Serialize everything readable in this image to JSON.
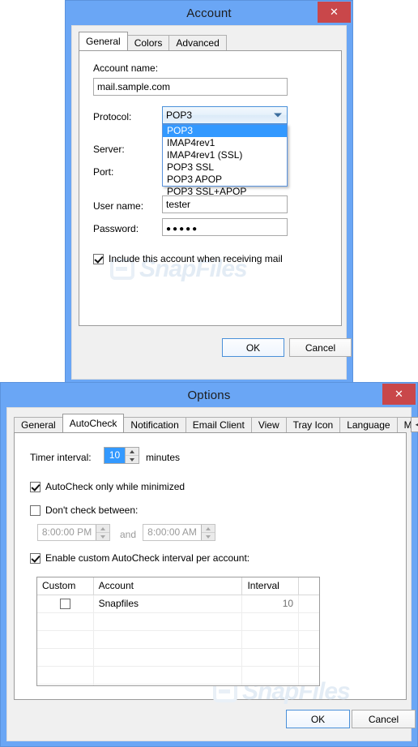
{
  "account_dialog": {
    "title": "Account",
    "close_label": "✕",
    "tabs": [
      {
        "label": "General",
        "active": true
      },
      {
        "label": "Colors",
        "active": false
      },
      {
        "label": "Advanced",
        "active": false
      }
    ],
    "fields": {
      "account_name_label": "Account name:",
      "account_name_value": "mail.sample.com",
      "protocol_label": "Protocol:",
      "protocol_value": "POP3",
      "server_label": "Server:",
      "port_label": "Port:",
      "user_name_label": "User name:",
      "user_name_value": "tester",
      "password_label": "Password:",
      "password_value": "●●●●●"
    },
    "protocol_options": [
      {
        "label": "POP3",
        "selected": true
      },
      {
        "label": "IMAP4rev1",
        "selected": false
      },
      {
        "label": "IMAP4rev1 (SSL)",
        "selected": false
      },
      {
        "label": "POP3 SSL",
        "selected": false
      },
      {
        "label": "POP3 APOP",
        "selected": false
      },
      {
        "label": "POP3 SSL+APOP",
        "selected": false
      }
    ],
    "include_checkbox": {
      "label": "Include this account when receiving mail",
      "checked": true
    },
    "buttons": {
      "ok": "OK",
      "cancel": "Cancel"
    },
    "watermark": "SnapFiles"
  },
  "options_dialog": {
    "title": "Options",
    "close_label": "✕",
    "tabs": [
      {
        "label": "General",
        "active": false
      },
      {
        "label": "AutoCheck",
        "active": true
      },
      {
        "label": "Notification",
        "active": false
      },
      {
        "label": "Email Client",
        "active": false
      },
      {
        "label": "View",
        "active": false
      },
      {
        "label": "Tray Icon",
        "active": false
      },
      {
        "label": "Language",
        "active": false
      },
      {
        "label": "Mouse A",
        "active": false
      }
    ],
    "tab_scroll_left": "◄",
    "tab_scroll_right": "►",
    "timer": {
      "label": "Timer interval:",
      "value": "10",
      "unit": "minutes"
    },
    "autocheck_minimized": {
      "label": "AutoCheck only while minimized",
      "checked": true
    },
    "dont_check": {
      "label": "Don't check between:",
      "checked": false,
      "from_value": "8:00:00 PM",
      "and_label": "and",
      "to_value": "8:00:00 AM"
    },
    "custom_interval": {
      "label": "Enable custom AutoCheck interval per account:",
      "checked": true
    },
    "grid": {
      "columns": [
        "Custom",
        "Account",
        "Interval"
      ],
      "rows": [
        {
          "custom_checked": false,
          "account": "Snapfiles",
          "interval": "10"
        }
      ],
      "empty_row_count": 8
    },
    "buttons": {
      "ok": "OK",
      "cancel": "Cancel"
    },
    "watermark": "SnapFiles"
  }
}
